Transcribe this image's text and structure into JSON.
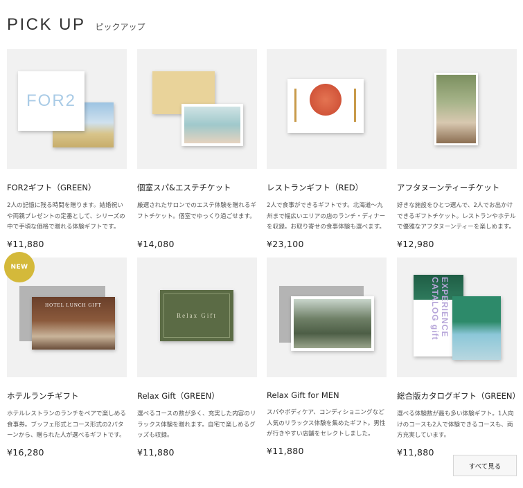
{
  "header": {
    "title": "PICK UP",
    "subtitle": "ピックアップ"
  },
  "products": [
    {
      "name": "FOR2ギフト（GREEN）",
      "desc": "2人の記憶に残る時間を贈ります。結婚祝いや両親プレゼントの定番として、シリーズの中で手頃な価格で贈れる体験ギフトです。",
      "price": "¥11,880",
      "cover_text": "FOR2",
      "badge": ""
    },
    {
      "name": "個室スパ&エステチケット",
      "desc": "厳選されたサロンでのエステ体験を贈れるギフトチケット。個室でゆっくり過ごせます。",
      "price": "¥14,080",
      "badge": ""
    },
    {
      "name": "レストランギフト（RED）",
      "desc": "2人で食事ができるギフトです。北海道〜九州まで幅広いエリアの店のランチ・ディナーを収録。お取り寄せの食事体験も選べます。",
      "price": "¥23,100",
      "badge": ""
    },
    {
      "name": "アフタヌーンティーチケット",
      "desc": "好きな施設をひとつ選んで、2人でお出かけできるギフトチケット。レストランやホテルで優雅なアフタヌーンティーを楽しめます。",
      "price": "¥12,980",
      "badge": ""
    },
    {
      "name": "ホテルランチギフト",
      "desc": "ホテルレストランのランチをペアで楽しめる食事券。ブッフェ形式とコース形式の2パターンから、贈られた人が選べるギフトです。",
      "price": "¥16,280",
      "badge": "NEW",
      "cover_text": "HOTEL LUNCH GIFT"
    },
    {
      "name": "Relax Gift（GREEN）",
      "desc": "選べるコースの数が多く、充実した内容のリラックス体験を贈れます。自宅で楽しめるグッズも収録。",
      "price": "¥11,880",
      "badge": "",
      "cover_text": "Relax Gift"
    },
    {
      "name": "Relax Gift for MEN",
      "desc": "スパやボディケア、コンディショニングなど人気のリラックス体験を集めたギフト。男性が行きやすい店舗をセレクトしました。",
      "price": "¥11,880",
      "badge": ""
    },
    {
      "name": "総合版カタログギフト（GREEN）",
      "desc": "選べる体験数が最も多い体験ギフト。1人向けのコースも2人で体験できるコースも、両方充実しています。",
      "price": "¥11,880",
      "badge": "",
      "cover_text": "EXPERIENCE CATALOG gift"
    }
  ],
  "see_all": {
    "label": "すべて見る"
  },
  "colors": {
    "badge": "#d4b93a",
    "thumb_bg": "#f1f1f1",
    "restaurant_red": "#d9553a",
    "relax_green": "#5b6b45"
  }
}
